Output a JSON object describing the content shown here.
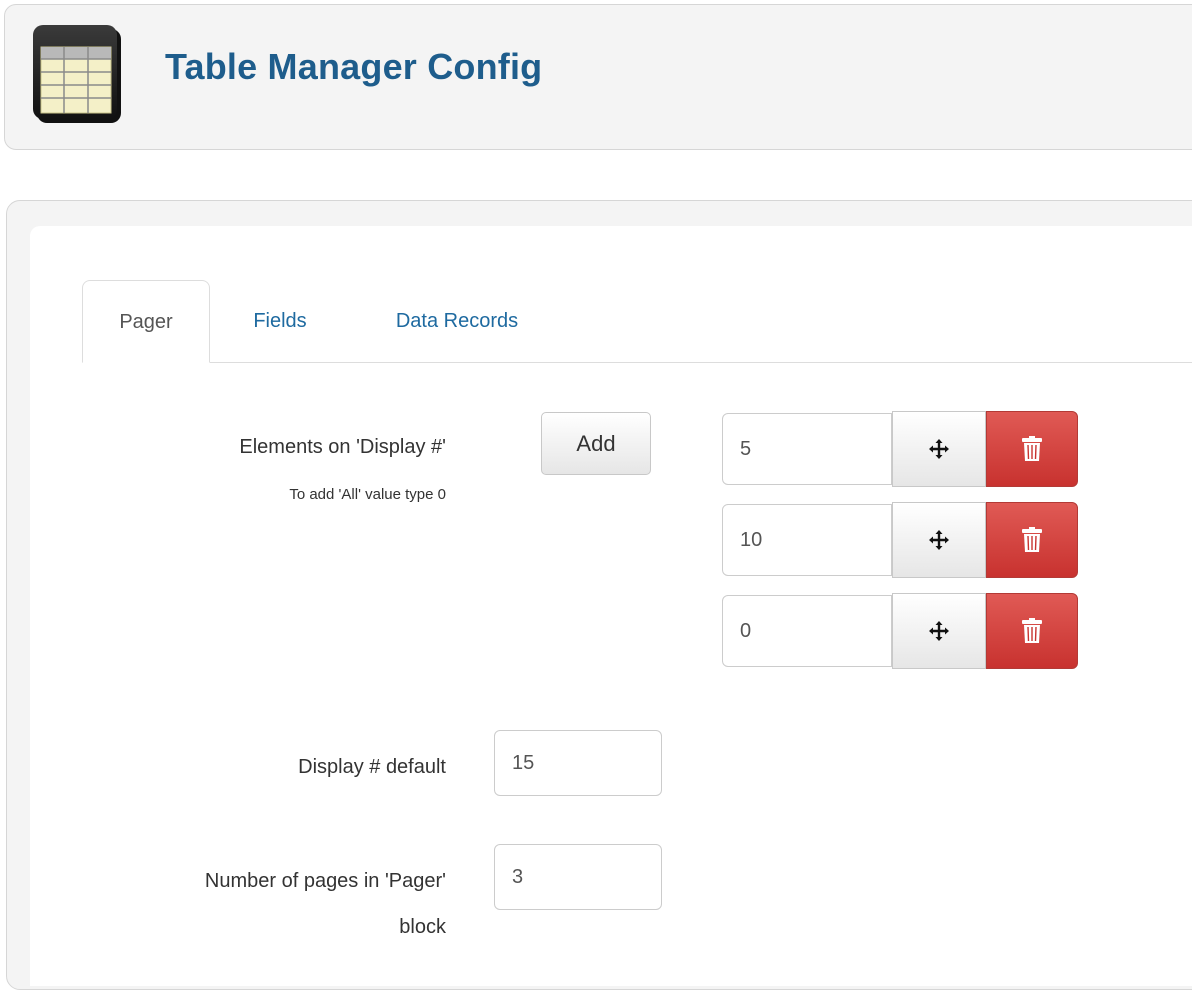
{
  "header": {
    "title": "Table Manager Config",
    "icon": "table-icon"
  },
  "tabs": [
    {
      "label": "Pager",
      "active": true
    },
    {
      "label": "Fields",
      "active": false
    },
    {
      "label": "Data Records",
      "active": false
    }
  ],
  "pager": {
    "elements_label": "Elements on 'Display #'",
    "elements_hint": "To add 'All' value type 0",
    "add_button": "Add",
    "display_values": [
      "5",
      "10",
      "0"
    ],
    "display_default_label": "Display # default",
    "display_default_value": "15",
    "pages_label_line1": "Number of pages in 'Pager'",
    "pages_label_line2": "block",
    "pages_value": "3"
  },
  "colors": {
    "title": "#1e5d8c",
    "link": "#1e6aa0",
    "danger": "#d9534f"
  },
  "icons": {
    "move": "move-arrows-icon",
    "delete": "trash-icon"
  }
}
